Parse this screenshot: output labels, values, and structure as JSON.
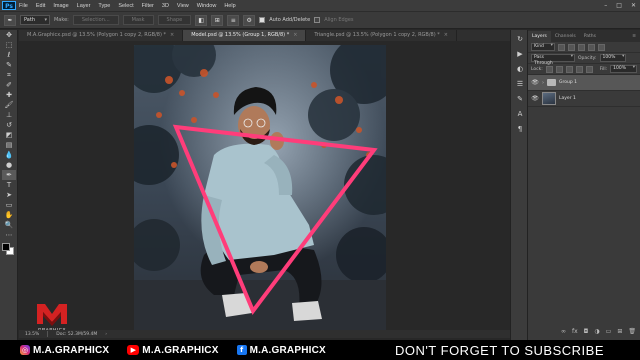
{
  "app": {
    "logo": "Ps"
  },
  "menu": [
    "File",
    "Edit",
    "Image",
    "Layer",
    "Type",
    "Select",
    "Filter",
    "3D",
    "View",
    "Window",
    "Help"
  ],
  "window_controls": [
    "–",
    "□",
    "✕"
  ],
  "options_bar": {
    "mode": "Path",
    "make_label": "Make:",
    "selection_btn": "Selection...",
    "mask_btn": "Mask",
    "shape_btn": "Shape",
    "auto_add_delete": "Auto Add/Delete",
    "auto_add_delete_checked": true,
    "align_edges": "Align Edges"
  },
  "tabs": [
    {
      "label": "M.A.Graphicx.psd @ 13.5% (Polygon 1 copy 2, RGB/8) *",
      "active": false
    },
    {
      "label": "Model.psd @ 13.5% (Group 1, RGB/8) *",
      "active": true
    },
    {
      "label": "Triangle.psd @ 13.5% (Polygon 1 copy 2, RGB/8) *",
      "active": false
    }
  ],
  "status": {
    "zoom": "13.5%",
    "doc": "Doc: 52.3M/59.4M"
  },
  "layers_panel": {
    "tabs": [
      "Layers",
      "Channels",
      "Paths"
    ],
    "active_tab": "Layers",
    "filter_kind": "Kind",
    "blend_mode": "Pass Through",
    "opacity_label": "Opacity:",
    "opacity_value": "100%",
    "lock_label": "Lock:",
    "fill_label": "Fill:",
    "fill_value": "100%",
    "layers": [
      {
        "name": "Group 1",
        "type": "group",
        "selected": true
      },
      {
        "name": "Layer 1",
        "type": "pixel",
        "selected": false
      }
    ]
  },
  "banner": {
    "instagram": "M.A.GRAPHICX",
    "youtube": "M.A.GRAPHICX",
    "facebook": "M.A.GRAPHICX",
    "cta": "DON'T FORGET TO SUBSCRIBE"
  },
  "watermark": {
    "letters": "M",
    "caption": "GRAPHICX"
  },
  "colors": {
    "triangle_stroke": "#ff3d7a",
    "accent": "#31a8ff"
  }
}
